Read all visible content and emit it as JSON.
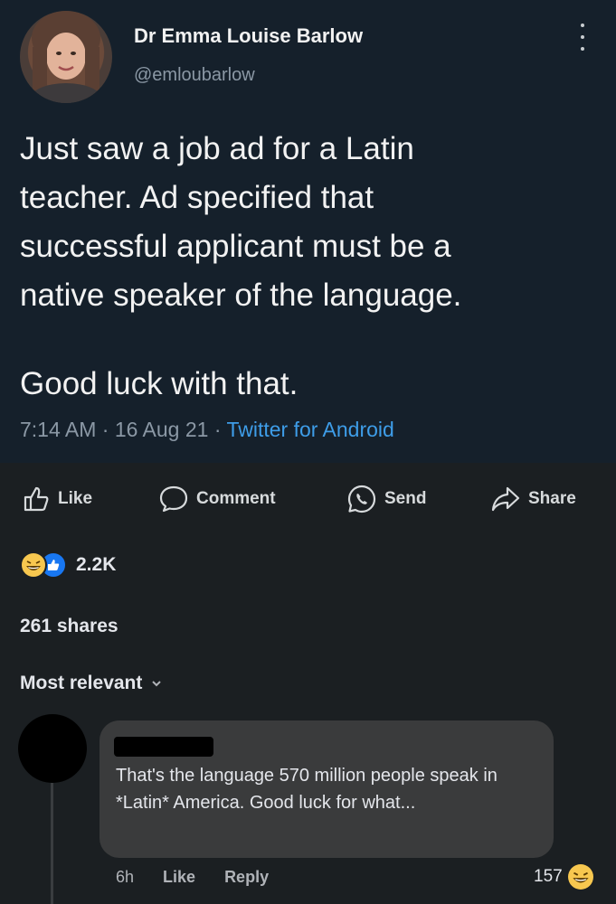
{
  "tweet": {
    "name": "Dr Emma Louise Barlow",
    "handle": "@emloubarlow",
    "lines": [
      "Just saw a job ad for a Latin",
      "teacher. Ad specified that",
      "successful applicant must be a",
      "native speaker of the language."
    ],
    "closing": "Good luck with that.",
    "time": "7:14 AM · 16 Aug 21 · ",
    "source": "Twitter for Android"
  },
  "actions": {
    "like": "Like",
    "comment": "Comment",
    "send": "Send",
    "share": "Share"
  },
  "reactions": {
    "count": "2.2K",
    "icons": [
      "laugh-emoji-icon",
      "thumbs-up-icon"
    ]
  },
  "shares": "261 shares",
  "sort": "Most relevant",
  "comment": {
    "text": "That's the language 570 million people speak in *Latin* America. Good luck for what...",
    "time": "6h",
    "like": "Like",
    "reply": "Reply",
    "reaction_count": "157"
  },
  "colors": {
    "tweet_bg": "#15202b",
    "page_bg": "#1b1f22",
    "link": "#3e9de8",
    "bubble": "#3a3b3c"
  }
}
